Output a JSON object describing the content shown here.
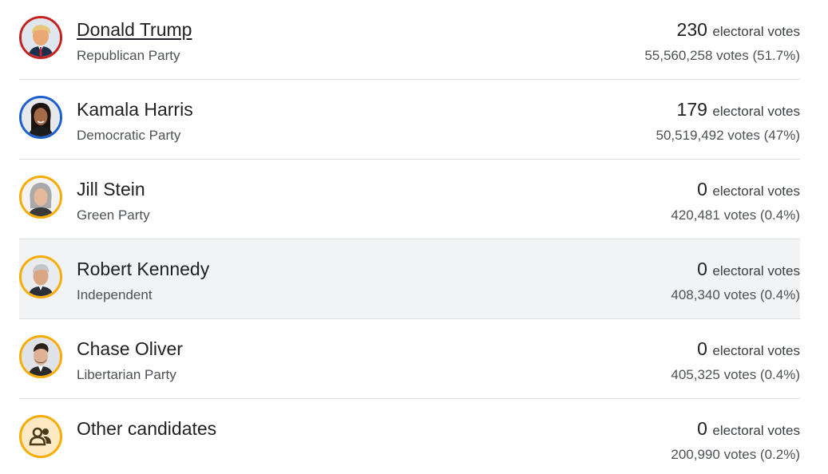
{
  "colors": {
    "republican": "#c5221f",
    "democratic": "#1a5fd0",
    "other": "#f9ab00",
    "divider": "#dadce0",
    "hover_bg": "#f1f3f4"
  },
  "electoral_label": "electoral votes",
  "candidates": [
    {
      "name": "Donald Trump",
      "party": "Republican Party",
      "electoral": "230",
      "popular": "55,560,258 votes (51.7%)",
      "icon": "donald-trump-photo"
    },
    {
      "name": "Kamala Harris",
      "party": "Democratic Party",
      "electoral": "179",
      "popular": "50,519,492 votes (47%)",
      "icon": "kamala-harris-photo"
    },
    {
      "name": "Jill Stein",
      "party": "Green Party",
      "electoral": "0",
      "popular": "420,481 votes (0.4%)",
      "icon": "jill-stein-photo"
    },
    {
      "name": "Robert Kennedy",
      "party": "Independent",
      "electoral": "0",
      "popular": "408,340 votes (0.4%)",
      "icon": "robert-kennedy-photo"
    },
    {
      "name": "Chase Oliver",
      "party": "Libertarian Party",
      "electoral": "0",
      "popular": "405,325 votes (0.4%)",
      "icon": "chase-oliver-photo"
    },
    {
      "name": "Other candidates",
      "party": "",
      "electoral": "0",
      "popular": "200,990 votes (0.2%)",
      "icon": "people-group-icon"
    }
  ]
}
